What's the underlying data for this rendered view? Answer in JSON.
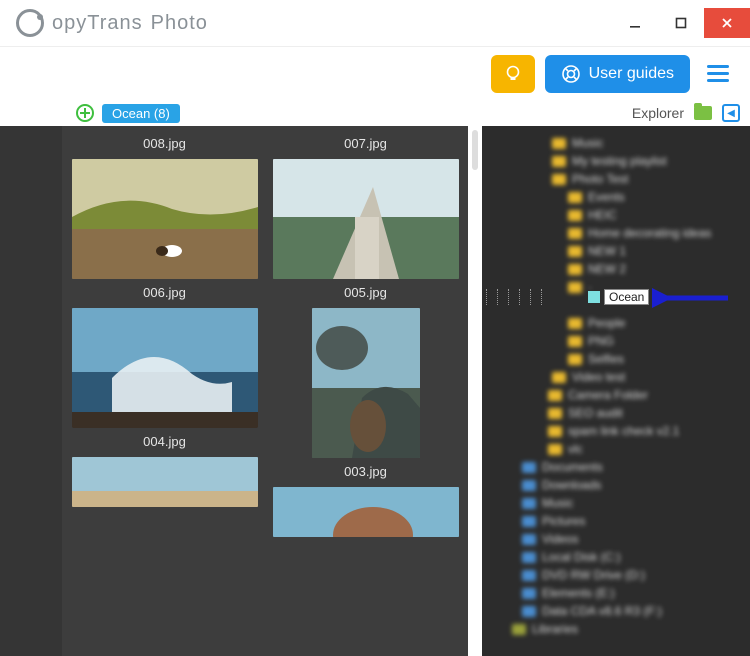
{
  "app": {
    "title_a": "opyTrans",
    "title_b": "Photo"
  },
  "window": {
    "close": "×"
  },
  "toolbar": {
    "user_guides": "User guides"
  },
  "subbar": {
    "tag": "Ocean (8)",
    "explorer": "Explorer"
  },
  "thumbs": {
    "img008": "008.jpg",
    "img007": "007.jpg",
    "img006": "006.jpg",
    "img005": "005.jpg",
    "img004": "004.jpg",
    "img003": "003.jpg"
  },
  "tree": {
    "drop_target": "Ocean",
    "items": [
      "Music",
      "My testing playlist",
      "Photo Test",
      "Events",
      "HEIC",
      "Home decorating ideas",
      "NEW 1",
      "NEW 2",
      "Ocean",
      "People",
      "PNG",
      "Selfies",
      "Video test",
      "Camera Folder",
      "SEO audit",
      "spam link check v2.1",
      "vlc",
      "Documents",
      "Downloads",
      "Music",
      "Pictures",
      "Videos",
      "Local Disk (C:)",
      "DVD RW Drive (D:)",
      "Elements (E:)",
      "Data CDA v8.6 R3 (F:)",
      "Libraries"
    ]
  },
  "colors": {
    "accent": "#1f8fe8",
    "tips": "#f7b500",
    "tag": "#29a3e6",
    "close": "#e74c3c"
  }
}
